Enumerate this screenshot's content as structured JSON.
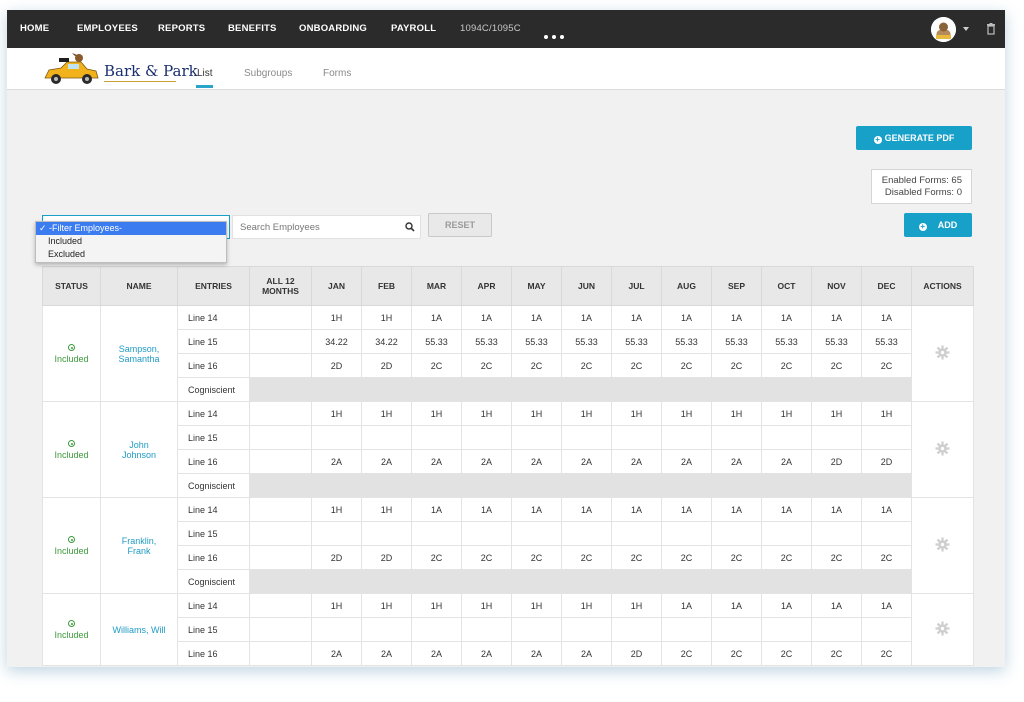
{
  "nav": {
    "items": [
      "HOME",
      "EMPLOYEES",
      "REPORTS",
      "BENEFITS",
      "ONBOARDING",
      "PAYROLL",
      "1094C/1095C"
    ],
    "more_icon": "ellipsis-icon",
    "avatar_icon": "user-avatar",
    "trash_icon": "trash-icon"
  },
  "brand": {
    "name": "Bark & Park"
  },
  "subnav": {
    "tabs": [
      "List",
      "Subgroups",
      "Forms"
    ],
    "active": "List"
  },
  "actions": {
    "generate_pdf": "GENERATE PDF",
    "add": "ADD"
  },
  "forms_summary": {
    "enabled": "Enabled Forms: 65",
    "disabled": "Disabled Forms: 0"
  },
  "filter": {
    "options": [
      "✓ -Filter Employees-",
      "Included",
      "Excluded"
    ],
    "selected": "-Filter Employees-"
  },
  "search": {
    "placeholder": "Search Employees",
    "value": ""
  },
  "reset_label": "RESET",
  "colors": {
    "accent": "#17a0c8",
    "nav_bg": "#2b2b2b",
    "included": "#3c9a3c",
    "link": "#1f9bc4"
  },
  "table": {
    "headers": [
      "STATUS",
      "NAME",
      "ENTRIES",
      "ALL 12 MONTHS",
      "JAN",
      "FEB",
      "MAR",
      "APR",
      "MAY",
      "JUN",
      "JUL",
      "AUG",
      "SEP",
      "OCT",
      "NOV",
      "DEC",
      "ACTIONS"
    ],
    "employees": [
      {
        "status": "Included",
        "name": "Sampson, Samantha",
        "rows": [
          {
            "label": "Line 14",
            "all": "",
            "months": [
              "1H",
              "1H",
              "1A",
              "1A",
              "1A",
              "1A",
              "1A",
              "1A",
              "1A",
              "1A",
              "1A",
              "1A"
            ]
          },
          {
            "label": "Line 15",
            "all": "",
            "months": [
              "34.22",
              "34.22",
              "55.33",
              "55.33",
              "55.33",
              "55.33",
              "55.33",
              "55.33",
              "55.33",
              "55.33",
              "55.33",
              "55.33"
            ]
          },
          {
            "label": "Line 16",
            "all": "",
            "months": [
              "2D",
              "2D",
              "2C",
              "2C",
              "2C",
              "2C",
              "2C",
              "2C",
              "2C",
              "2C",
              "2C",
              "2C"
            ]
          },
          {
            "label": "Cogniscient",
            "shaded": true
          }
        ]
      },
      {
        "status": "Included",
        "name": "John Johnson",
        "rows": [
          {
            "label": "Line 14",
            "all": "",
            "months": [
              "1H",
              "1H",
              "1H",
              "1H",
              "1H",
              "1H",
              "1H",
              "1H",
              "1H",
              "1H",
              "1H",
              "1H"
            ]
          },
          {
            "label": "Line 15",
            "all": "",
            "months": [
              "",
              "",
              "",
              "",
              "",
              "",
              "",
              "",
              "",
              "",
              "",
              ""
            ]
          },
          {
            "label": "Line 16",
            "all": "",
            "months": [
              "2A",
              "2A",
              "2A",
              "2A",
              "2A",
              "2A",
              "2A",
              "2A",
              "2A",
              "2A",
              "2D",
              "2D"
            ]
          },
          {
            "label": "Cogniscient",
            "shaded": true
          }
        ]
      },
      {
        "status": "Included",
        "name": "Franklin, Frank",
        "rows": [
          {
            "label": "Line 14",
            "all": "",
            "months": [
              "1H",
              "1H",
              "1A",
              "1A",
              "1A",
              "1A",
              "1A",
              "1A",
              "1A",
              "1A",
              "1A",
              "1A"
            ]
          },
          {
            "label": "Line 15",
            "all": "",
            "months": [
              "",
              "",
              "",
              "",
              "",
              "",
              "",
              "",
              "",
              "",
              "",
              ""
            ]
          },
          {
            "label": "Line 16",
            "all": "",
            "months": [
              "2D",
              "2D",
              "2C",
              "2C",
              "2C",
              "2C",
              "2C",
              "2C",
              "2C",
              "2C",
              "2C",
              "2C"
            ]
          },
          {
            "label": "Cogniscient",
            "shaded": true
          }
        ]
      },
      {
        "status": "Included",
        "name": "Williams, Will",
        "rows": [
          {
            "label": "Line 14",
            "all": "",
            "months": [
              "1H",
              "1H",
              "1H",
              "1H",
              "1H",
              "1H",
              "1H",
              "1A",
              "1A",
              "1A",
              "1A",
              "1A"
            ]
          },
          {
            "label": "Line 15",
            "all": "",
            "months": [
              "",
              "",
              "",
              "",
              "",
              "",
              "",
              "",
              "",
              "",
              "",
              ""
            ]
          },
          {
            "label": "Line 16",
            "all": "",
            "months": [
              "2A",
              "2A",
              "2A",
              "2A",
              "2A",
              "2A",
              "2D",
              "2C",
              "2C",
              "2C",
              "2C",
              "2C"
            ]
          }
        ]
      }
    ]
  }
}
